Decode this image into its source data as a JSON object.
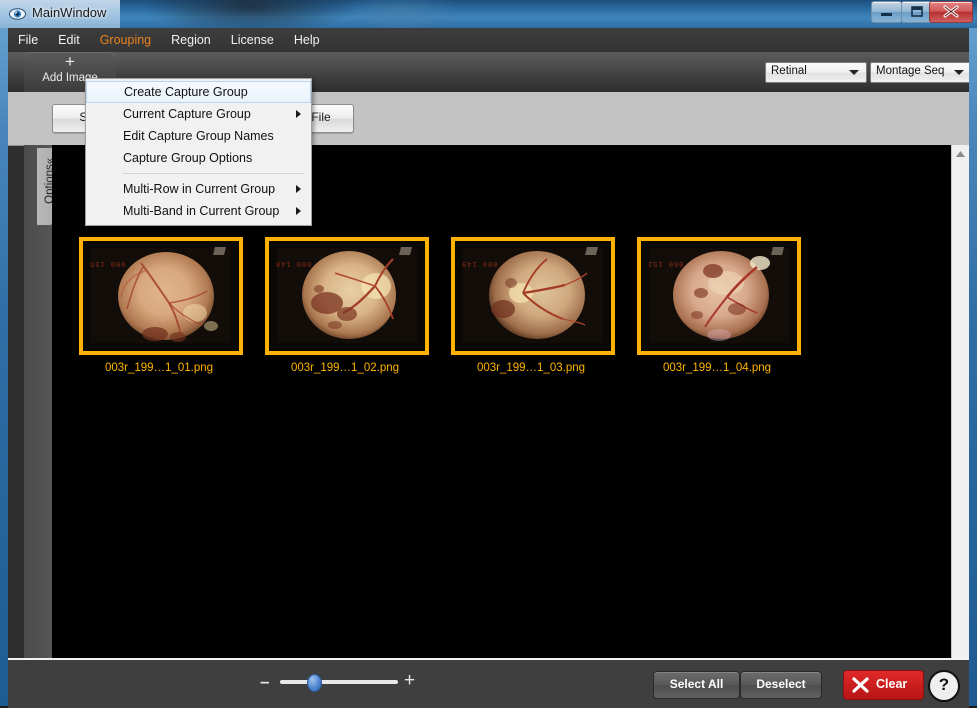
{
  "window": {
    "title": "MainWindow",
    "icon": "eye-icon",
    "buttons": {
      "minimize": "minimize-icon",
      "maximize": "maximize-icon",
      "close": "close-icon"
    }
  },
  "menubar": {
    "items": [
      {
        "label": "File",
        "active": false
      },
      {
        "label": "Edit",
        "active": false
      },
      {
        "label": "Grouping",
        "active": true
      },
      {
        "label": "Region",
        "active": false
      },
      {
        "label": "License",
        "active": false
      },
      {
        "label": "Help",
        "active": false
      }
    ],
    "active_color": "#e8821e"
  },
  "dropdown": {
    "owner": "Grouping",
    "items": [
      {
        "label": "Create Capture Group",
        "submenu": false,
        "hovered": true
      },
      {
        "label": "Current Capture Group",
        "submenu": true,
        "hovered": false
      },
      {
        "label": "Edit Capture Group Names",
        "submenu": false,
        "hovered": false
      },
      {
        "label": "Capture Group Options",
        "submenu": false,
        "hovered": false
      },
      {
        "separator": true
      },
      {
        "label": "Multi-Row in Current Group",
        "submenu": true,
        "hovered": false
      },
      {
        "label": "Multi-Band in Current Group",
        "submenu": true,
        "hovered": false
      }
    ]
  },
  "toolbar": {
    "add_image_tab": {
      "label": "Add Image",
      "icon": "plus-icon"
    },
    "modality_select": {
      "value": "Retinal"
    },
    "mode_select": {
      "value": "Montage Seq"
    }
  },
  "subbar": {
    "select_file_button": "Select...",
    "next_file_button": "Next File"
  },
  "options_panel": {
    "label": "Options",
    "collapse_icon": "«"
  },
  "thumbnails": {
    "selection_color": "#ffb300",
    "items": [
      {
        "caption": "003r_199…1_01.png",
        "burn_text": "000 155",
        "selected": true
      },
      {
        "caption": "003r_199…1_02.png",
        "burn_text": "000 148",
        "selected": true
      },
      {
        "caption": "003r_199…1_03.png",
        "burn_text": "000 149",
        "selected": true
      },
      {
        "caption": "003r_199…1_04.png",
        "burn_text": "000 152",
        "selected": true
      }
    ]
  },
  "scrollbar": {
    "up_icon": "scroll-up-icon",
    "down_icon": "scroll-down-icon"
  },
  "bottombar": {
    "zoom_out_label": "–",
    "zoom_in_label": "+",
    "zoom_value_percent": 25,
    "select_all_button": "Select All",
    "deselect_button": "Deselect",
    "clear_button": "Clear",
    "clear_icon": "x-icon",
    "clear_color": "#cc1e1e",
    "help_button": "?"
  }
}
